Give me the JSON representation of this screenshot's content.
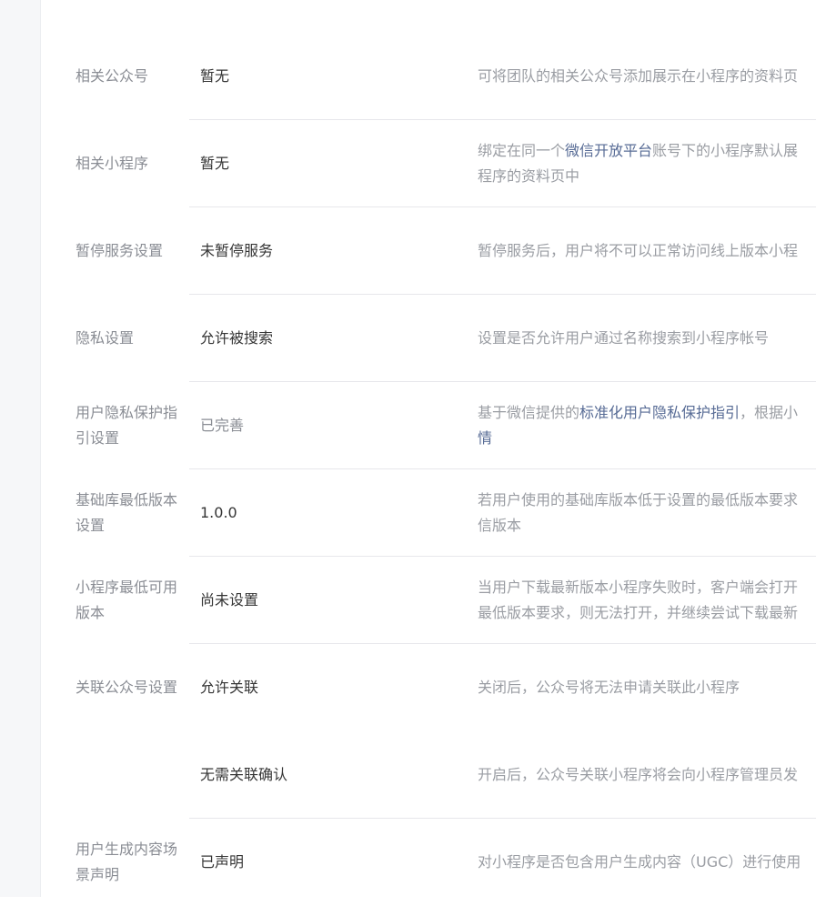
{
  "rows": [
    {
      "label": "相关公众号",
      "value": "暂无",
      "desc_pre": "可将团队的相关公众号添加展示在小程序的资料页",
      "desc_link": "",
      "desc_post": "",
      "desc_line2_link": "",
      "desc_line2": ""
    },
    {
      "label": "相关小程序",
      "value": "暂无",
      "desc_pre": "绑定在同一个",
      "desc_link": "微信开放平台",
      "desc_post": "账号下的小程序默认展",
      "desc_line2_link": "",
      "desc_line2": "程序的资料页中"
    },
    {
      "label": "暂停服务设置",
      "value": "未暂停服务",
      "desc_pre": "暂停服务后，用户将不可以正常访问线上版本小程",
      "desc_link": "",
      "desc_post": "",
      "desc_line2_link": "",
      "desc_line2": ""
    },
    {
      "label": "隐私设置",
      "value": "允许被搜索",
      "desc_pre": "设置是否允许用户通过名称搜索到小程序帐号",
      "desc_link": "",
      "desc_post": "",
      "desc_line2_link": "",
      "desc_line2": ""
    },
    {
      "label": "用户隐私保护指引设置",
      "value": "已完善",
      "desc_pre": "基于微信提供的",
      "desc_link": "标准化用户隐私保护指引",
      "desc_post": "，根据小",
      "desc_line2_link": "情",
      "desc_line2": ""
    },
    {
      "label": "基础库最低版本设置",
      "value": "1.0.0",
      "desc_pre": "若用户使用的基础库版本低于设置的最低版本要求",
      "desc_link": "",
      "desc_post": "",
      "desc_line2_link": "",
      "desc_line2": "信版本"
    },
    {
      "label": "小程序最低可用版本",
      "value": "尚未设置",
      "desc_pre": "当用户下载最新版本小程序失败时，客户端会打开",
      "desc_link": "",
      "desc_post": "",
      "desc_line2_link": "",
      "desc_line2": "最低版本要求，则无法打开，并继续尝试下载最新"
    },
    {
      "label": "关联公众号设置",
      "value": "允许关联",
      "desc_pre": "关闭后，公众号将无法申请关联此小程序",
      "desc_link": "",
      "desc_post": "",
      "desc_line2_link": "",
      "desc_line2": ""
    },
    {
      "label": "",
      "value": "无需关联确认",
      "desc_pre": "开启后，公众号关联小程序将会向小程序管理员发",
      "desc_link": "",
      "desc_post": "",
      "desc_line2_link": "",
      "desc_line2": ""
    },
    {
      "label": "用户生成内容场景声明",
      "value": "已声明",
      "desc_pre": "对小程序是否包含用户生成内容（UGC）进行使用",
      "desc_link": "",
      "desc_post": "",
      "desc_line2_link": "",
      "desc_line2": ""
    }
  ]
}
